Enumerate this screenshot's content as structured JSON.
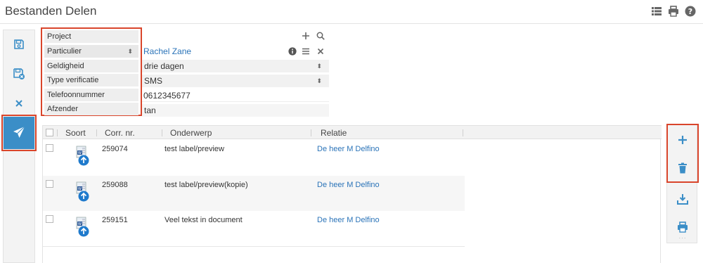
{
  "page": {
    "title": "Bestanden Delen"
  },
  "top_icons": [
    "list-view-icon",
    "print-icon",
    "help-icon"
  ],
  "left_toolbar": [
    "save-icon",
    "save-close-icon",
    "close-icon",
    "send-icon"
  ],
  "form": {
    "project": {
      "label": "Project",
      "value": ""
    },
    "particulier": {
      "label": "Particulier",
      "value": "Rachel Zane"
    },
    "geldigheid": {
      "label": "Geldigheid",
      "value": "drie dagen"
    },
    "type_verificatie": {
      "label": "Type verificatie",
      "value": "SMS"
    },
    "telefoonnummer": {
      "label": "Telefoonnummer",
      "value": "0612345677"
    },
    "afzender": {
      "label": "Afzender",
      "value": "tan"
    }
  },
  "table": {
    "headers": {
      "soort": "Soort",
      "corr_nr": "Corr. nr.",
      "onderwerp": "Onderwerp",
      "relatie": "Relatie"
    },
    "rows": [
      {
        "corr_nr": "259074",
        "onderwerp": "test label/preview",
        "relatie": "De heer M Delfino"
      },
      {
        "corr_nr": "259088",
        "onderwerp": "test label/preview(kopie)",
        "relatie": "De heer M Delfino"
      },
      {
        "corr_nr": "259151",
        "onderwerp": "Veel tekst in document",
        "relatie": "De heer M Delfino"
      }
    ]
  },
  "right_toolbar": [
    "add-icon",
    "delete-icon",
    "download-icon",
    "print-icon"
  ],
  "colors": {
    "accent": "#3b8ec7",
    "highlight": "#d9452b",
    "link": "#2a73b8"
  }
}
